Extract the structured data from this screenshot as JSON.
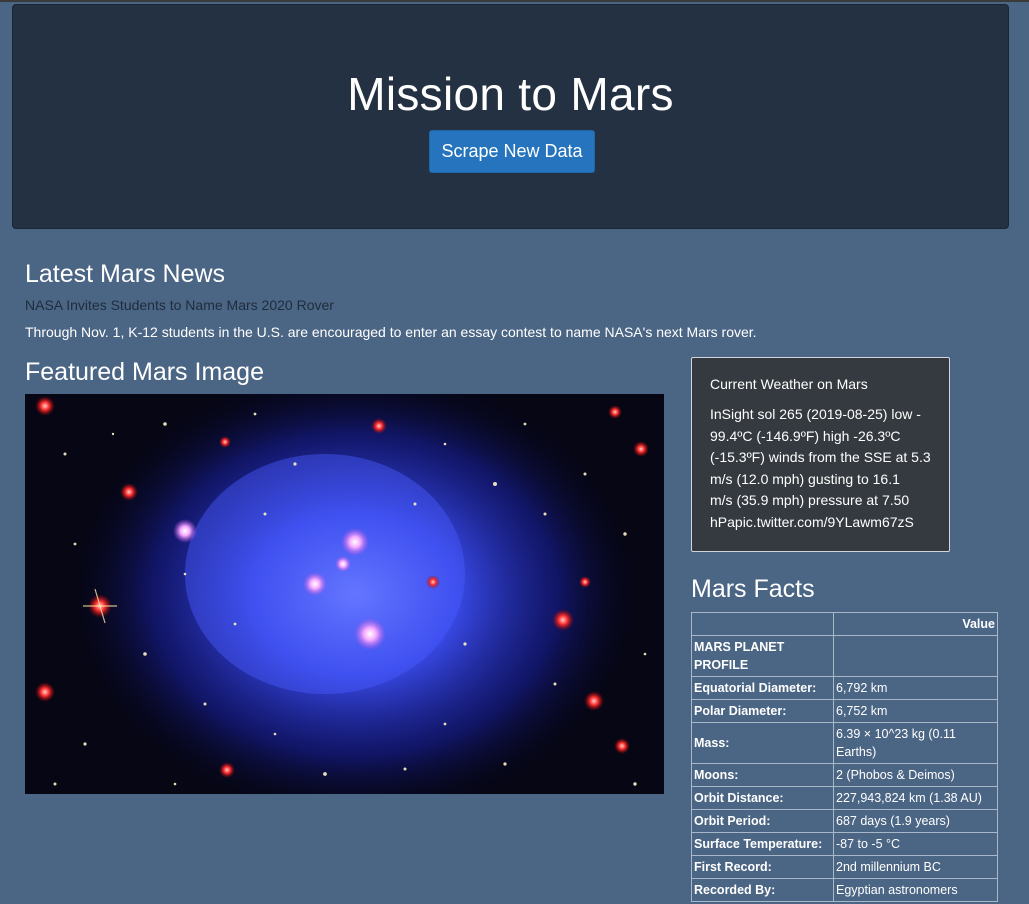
{
  "header": {
    "title": "Mission to Mars",
    "scrape_button": "Scrape New Data"
  },
  "news": {
    "heading": "Latest Mars News",
    "title": "NASA Invites Students to Name Mars 2020 Rover",
    "body": "Through Nov. 1, K-12 students in the U.S. are encouraged to enter an essay contest to name NASA's next Mars rover."
  },
  "featured": {
    "heading": "Featured Mars Image"
  },
  "weather": {
    "title": "Current Weather on Mars",
    "lines": [
      "InSight sol 265 (2019-08-25) low -",
      "99.4ºC (-146.9ºF) high -26.3ºC",
      "(-15.3ºF) winds from the SSE at 5.3",
      "m/s (12.0 mph) gusting to 16.1",
      "m/s (35.9 mph) pressure at 7.50",
      "hPapic.twitter.com/9YLawm67zS"
    ]
  },
  "facts": {
    "heading": "Mars Facts",
    "header_blank": "",
    "header_value": "Value",
    "rows": [
      {
        "key": "MARS PLANET PROFILE",
        "value": ""
      },
      {
        "key": "Equatorial Diameter:",
        "value": "6,792 km"
      },
      {
        "key": "Polar Diameter:",
        "value": "6,752 km"
      },
      {
        "key": "Mass:",
        "value": "6.39 × 10^23 kg (0.11 Earths)"
      },
      {
        "key": "Moons:",
        "value": "2 (Phobos & Deimos)"
      },
      {
        "key": "Orbit Distance:",
        "value": "227,943,824 km (1.38 AU)"
      },
      {
        "key": "Orbit Period:",
        "value": "687 days (1.9 years)"
      },
      {
        "key": "Surface Temperature:",
        "value": "-87 to -5 °C"
      },
      {
        "key": "First Record:",
        "value": "2nd millennium BC"
      },
      {
        "key": "Recorded By:",
        "value": "Egyptian astronomers"
      }
    ]
  }
}
